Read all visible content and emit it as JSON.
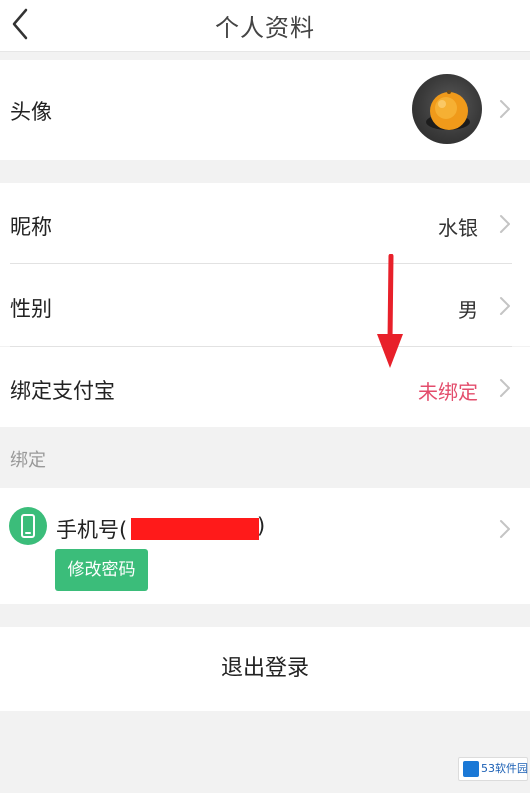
{
  "header": {
    "title": "个人资料",
    "back_icon": "chevron-left-icon"
  },
  "profile": {
    "avatar": {
      "label": "头像"
    },
    "nickname": {
      "label": "昵称",
      "value": "水银"
    },
    "gender": {
      "label": "性别",
      "value": "男"
    },
    "alipay": {
      "label": "绑定支付宝",
      "value": "未绑定",
      "value_color": "#e34d6c"
    }
  },
  "binding_section": {
    "label": "绑定",
    "phone": {
      "label": "手机号(",
      "label_close": ")",
      "icon": "phone-icon"
    },
    "change_password_label": "修改密码"
  },
  "logout_label": "退出登录",
  "watermark": {
    "text": "53软件园"
  },
  "colors": {
    "accent_green": "#3bbd7a",
    "alipay_unbound": "#e34d6c",
    "annotation_arrow": "#e8202a",
    "redaction": "#ff1a1a"
  }
}
